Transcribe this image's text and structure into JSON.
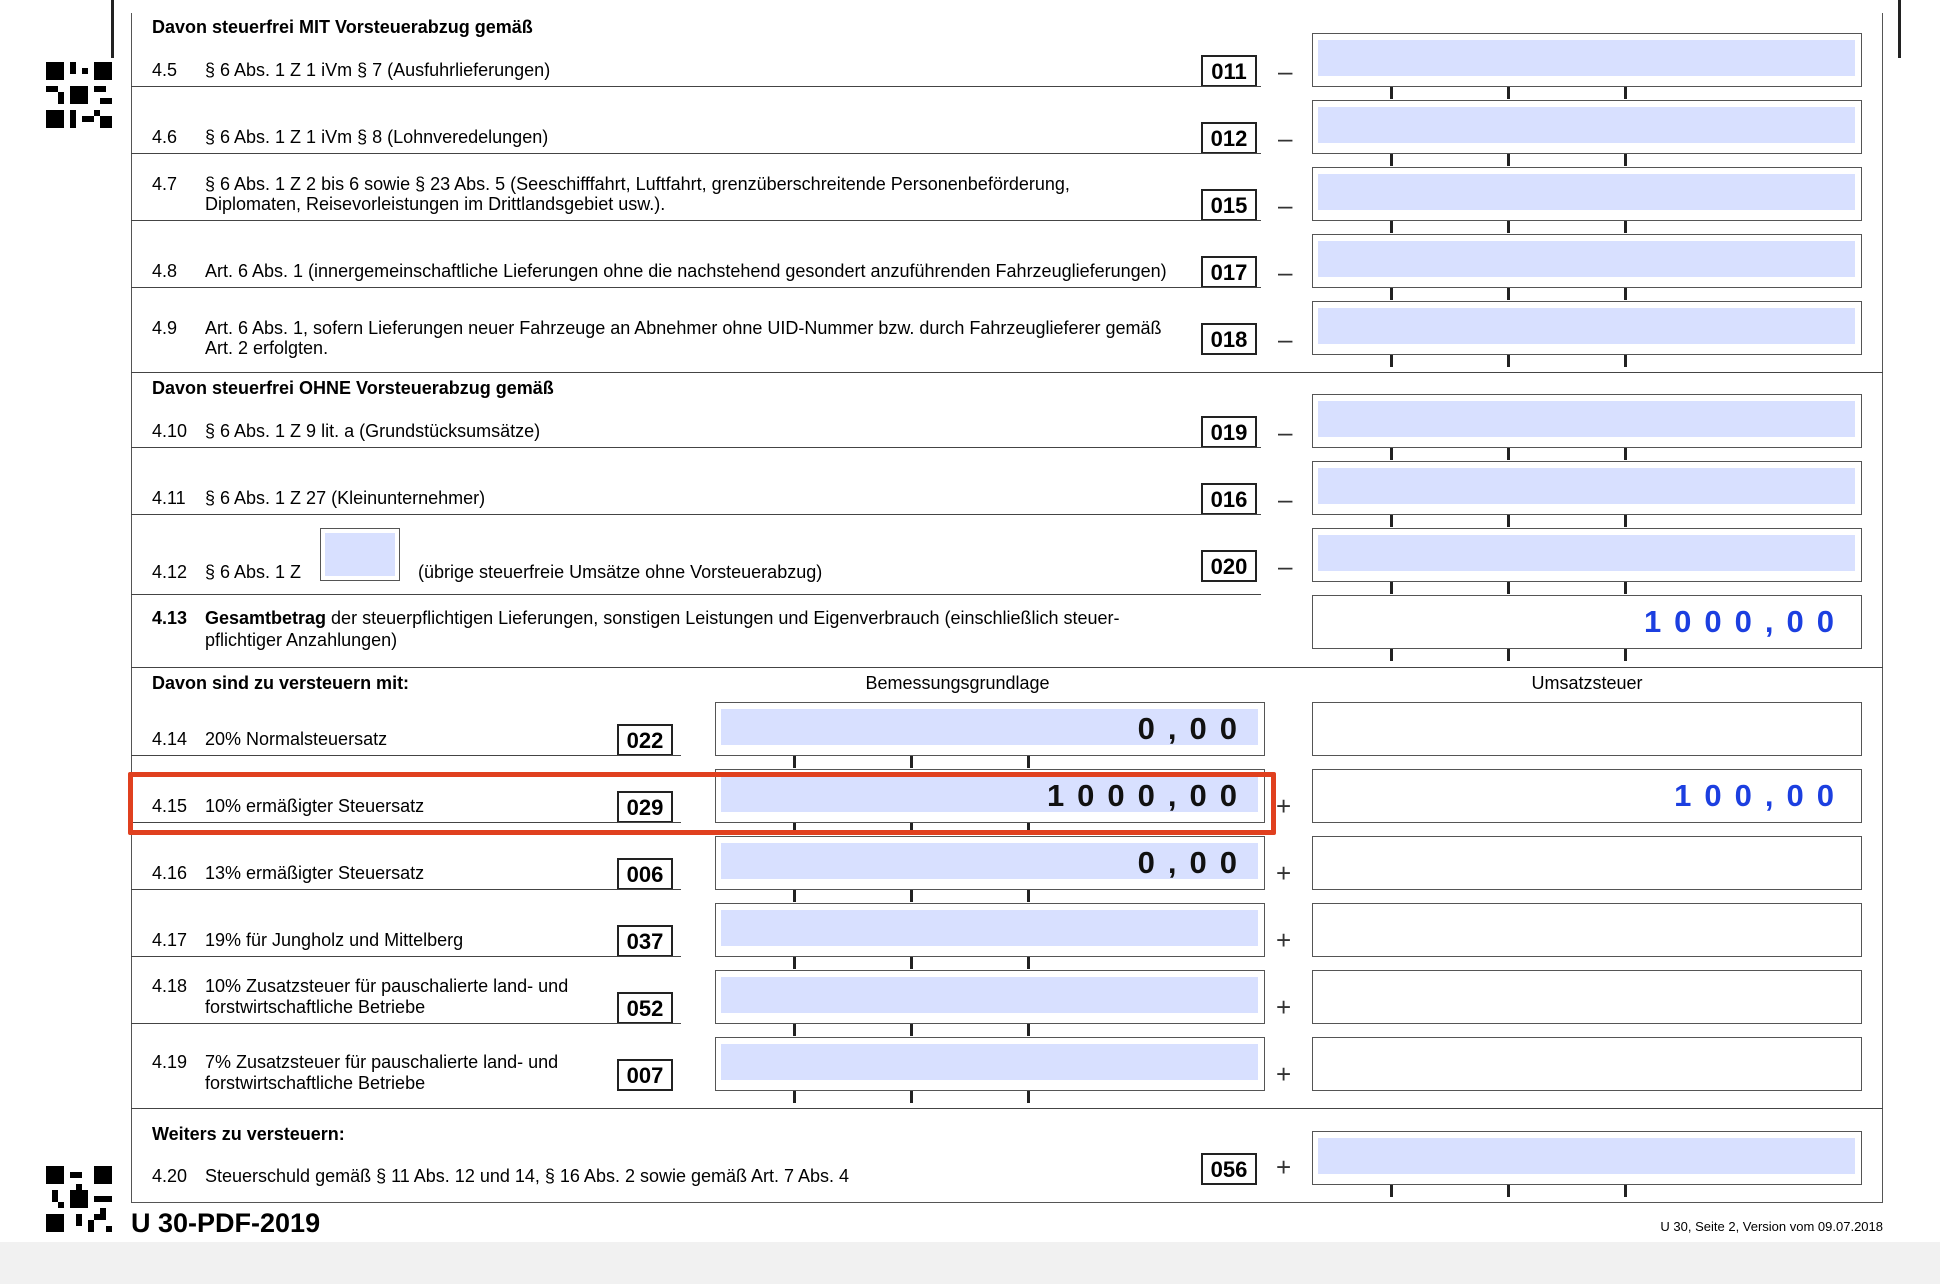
{
  "sections": {
    "mit": "Davon steuerfrei MIT Vorsteuerabzug gemäß",
    "ohne": "Davon steuerfrei OHNE Vorsteuerabzug gemäß",
    "versteuern": "Davon sind zu versteuern mit:",
    "weiters": "Weiters zu versteuern:"
  },
  "col_headers": {
    "bemessung": "Bemessungsgrundlage",
    "umsatzsteuer": "Umsatzsteuer"
  },
  "rows_exempt": [
    {
      "num": "4.5",
      "text": "§ 6 Abs. 1 Z 1 iVm § 7 (Ausfuhrlieferungen)",
      "code": "011",
      "sign": "–"
    },
    {
      "num": "4.6",
      "text": "§ 6 Abs. 1 Z 1 iVm § 8 (Lohnveredelungen)",
      "code": "012",
      "sign": "–"
    },
    {
      "num": "4.7",
      "text1": "§ 6 Abs. 1 Z 2 bis 6 sowie § 23 Abs. 5 (Seeschifffahrt, Luftfahrt, grenzüberschreitende Personenbeförderung,",
      "text2": "Diplomaten, Reisevorleistungen im Drittlandsgebiet usw.).",
      "code": "015",
      "sign": "–"
    },
    {
      "num": "4.8",
      "text": "Art. 6 Abs. 1 (innergemeinschaftliche Lieferungen ohne die nachstehend gesondert anzuführenden Fahrzeuglieferungen)",
      "code": "017",
      "sign": "–"
    },
    {
      "num": "4.9",
      "text1": "Art. 6 Abs. 1, sofern Lieferungen neuer Fahrzeuge an Abnehmer ohne UID-Nummer bzw. durch Fahrzeuglieferer gemäß",
      "text2": "Art. 2 erfolgten.",
      "code": "018",
      "sign": "–"
    },
    {
      "num": "4.10",
      "text": "§ 6 Abs. 1 Z 9 lit. a (Grundstücksumsätze)",
      "code": "019",
      "sign": "–"
    },
    {
      "num": "4.11",
      "text": "§ 6 Abs. 1 Z 27 (Kleinunternehmer)",
      "code": "016",
      "sign": "–"
    },
    {
      "num": "4.12",
      "text_a": "§ 6 Abs. 1 Z",
      "text_b": "(übrige steuerfreie Umsätze ohne Vorsteuerabzug)",
      "code": "020",
      "sign": "–"
    }
  ],
  "row_413": {
    "num": "4.13",
    "bold": "Gesamtbetrag",
    "text1": " der steuerpflichtigen Lieferungen, sonstigen Leistungen und Eigenverbrauch (einschließlich steuer-",
    "text2": "pflichtiger Anzahlungen)",
    "value": "1000,00"
  },
  "rows_taxed": [
    {
      "num": "4.14",
      "text": "20% Normalsteuersatz",
      "code": "022",
      "base": "0,00",
      "tax": "",
      "sign": ""
    },
    {
      "num": "4.15",
      "text": "10% ermäßigter Steuersatz",
      "code": "029",
      "base": "1000,00",
      "tax": "100,00",
      "sign": "+"
    },
    {
      "num": "4.16",
      "text": "13% ermäßigter Steuersatz",
      "code": "006",
      "base": "0,00",
      "tax": "",
      "sign": "+"
    },
    {
      "num": "4.17",
      "text": "19% für Jungholz und Mittelberg",
      "code": "037",
      "base": "",
      "tax": "",
      "sign": "+"
    },
    {
      "num": "4.18",
      "text1": "10% Zusatzsteuer für pauschalierte land- und",
      "text2": "forstwirtschaftliche Betriebe",
      "code": "052",
      "base": "",
      "tax": "",
      "sign": "+"
    },
    {
      "num": "4.19",
      "text1": "7% Zusatzsteuer für pauschalierte land- und",
      "text2": "forstwirtschaftliche Betriebe",
      "code": "007",
      "base": "",
      "tax": "",
      "sign": "+"
    }
  ],
  "row_420": {
    "num": "4.20",
    "text": "Steuerschuld gemäß § 11 Abs. 12 und 14, § 16 Abs. 2 sowie gemäß Art. 7 Abs. 4",
    "code": "056",
    "sign": "+"
  },
  "footer": {
    "title": "U 30-PDF-2019",
    "version": "U 30, Seite 2, Version vom 09.07.2018"
  },
  "colors": {
    "highlight": "#e0401f",
    "fill": "#d8e0ff",
    "value_blue": "#1c3fe0"
  }
}
